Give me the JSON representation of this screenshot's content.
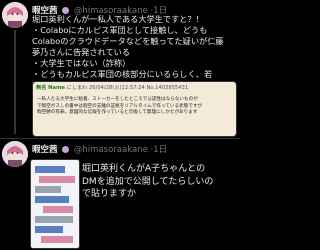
{
  "post1": {
    "name": "暇空茜",
    "handle": "@himasoraakane",
    "time": "·1日",
    "body": "堀口英利くんが一私人である大学生ですと？！\n・Colaboにカルピス軍団として接触し、どうも\nColaboのクラウドデータなどを触ってた疑いが仁藤\n夢乃さんに告発されている\n・大学生ではない（詐称）\n・どうもカルピス軍団の核部分にいるらしく、若\n下の新生要や石黒正数さんetcの被害の原因ぽい",
    "quote": {
      "name": "無名 Name",
      "meta": "にしまわ 26/04/28(火)12:57:24 No.1403955431",
      "body": "一私人たる大学生に粘着、ストーカーをしたところで公認性はならないものが\nで暇空ボスしの書中は暇空の支離の証拠をリアルタイムで作っている状態ですが\n暇空勝の有罪。意図的な信報を作っていると示唆して無理にしかたがあります"
    }
  },
  "post2": {
    "name": "暇空茜",
    "handle": "@himasoraakane",
    "time": "·1日",
    "body": "堀口英利くんがA子ちゃんとの\nDMを追加で公開してたらしいの\nで貼りますか"
  }
}
